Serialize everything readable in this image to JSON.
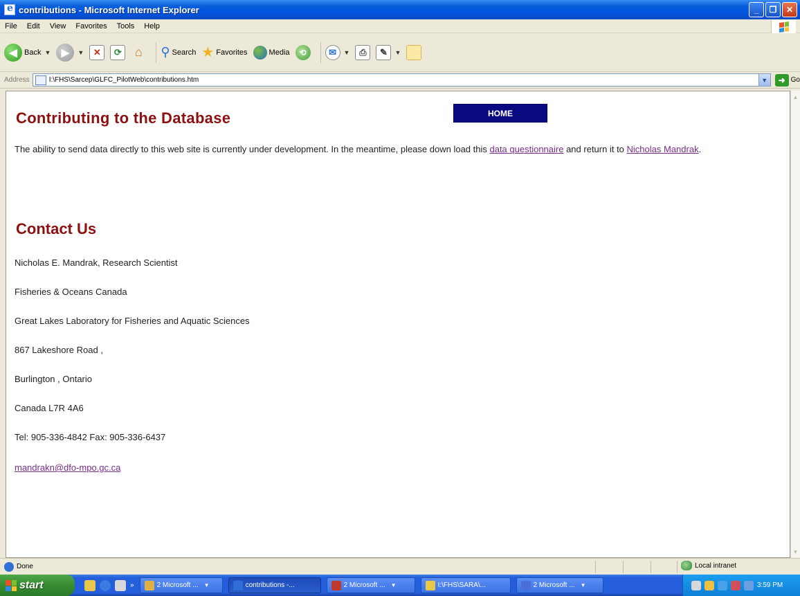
{
  "window": {
    "title": "contributions - Microsoft Internet Explorer",
    "controls": [
      "minimize",
      "maximize",
      "close"
    ]
  },
  "menu": [
    "File",
    "Edit",
    "View",
    "Favorites",
    "Tools",
    "Help"
  ],
  "toolbar": {
    "back_label": "Back",
    "search_label": "Search",
    "favorites_label": "Favorites",
    "media_label": "Media"
  },
  "address": {
    "label": "Address",
    "url": "I:\\FHS\\Sarcep\\GLFC_PilotWeb\\contributions.htm",
    "go_label": "Go"
  },
  "page": {
    "heading": "Contributing to the Database",
    "home_button": "HOME",
    "intro_before_link": "The ability to send data directly to this web site is currently under development. In the meantime, please down load this ",
    "intro_link": "data questionnaire",
    "intro_middle": " and return it to ",
    "intro_link2": "Nicholas Mandrak",
    "intro_end": ".",
    "contact_heading": "Contact Us",
    "contact_lines": [
      "Nicholas E. Mandrak, Research Scientist",
      "Fisheries & Oceans Canada",
      "Great Lakes Laboratory for Fisheries and Aquatic Sciences",
      "867 Lakeshore Road ,",
      "Burlington , Ontario",
      "Canada L7R 4A6",
      "Tel: 905-336-4842 Fax:  905-336-6437"
    ],
    "contact_email": "mandrakn@dfo-mpo.gc.ca"
  },
  "status": {
    "left": "Done",
    "zone": "Local intranet"
  },
  "taskbar": {
    "start_label": "start",
    "tasks": [
      {
        "label": "2 Microsoft ...",
        "active": false,
        "color": "#e0b040"
      },
      {
        "label": "contributions -...",
        "active": true,
        "color": "#2f6fd6"
      },
      {
        "label": "2 Microsoft ...",
        "active": false,
        "color": "#c0392b"
      },
      {
        "label": "I:\\FHS\\SARA\\...",
        "active": false,
        "color": "#e8c84a"
      },
      {
        "label": "2 Microsoft ...",
        "active": false,
        "color": "#4a6fd8"
      }
    ],
    "clock": "3:59 PM"
  }
}
